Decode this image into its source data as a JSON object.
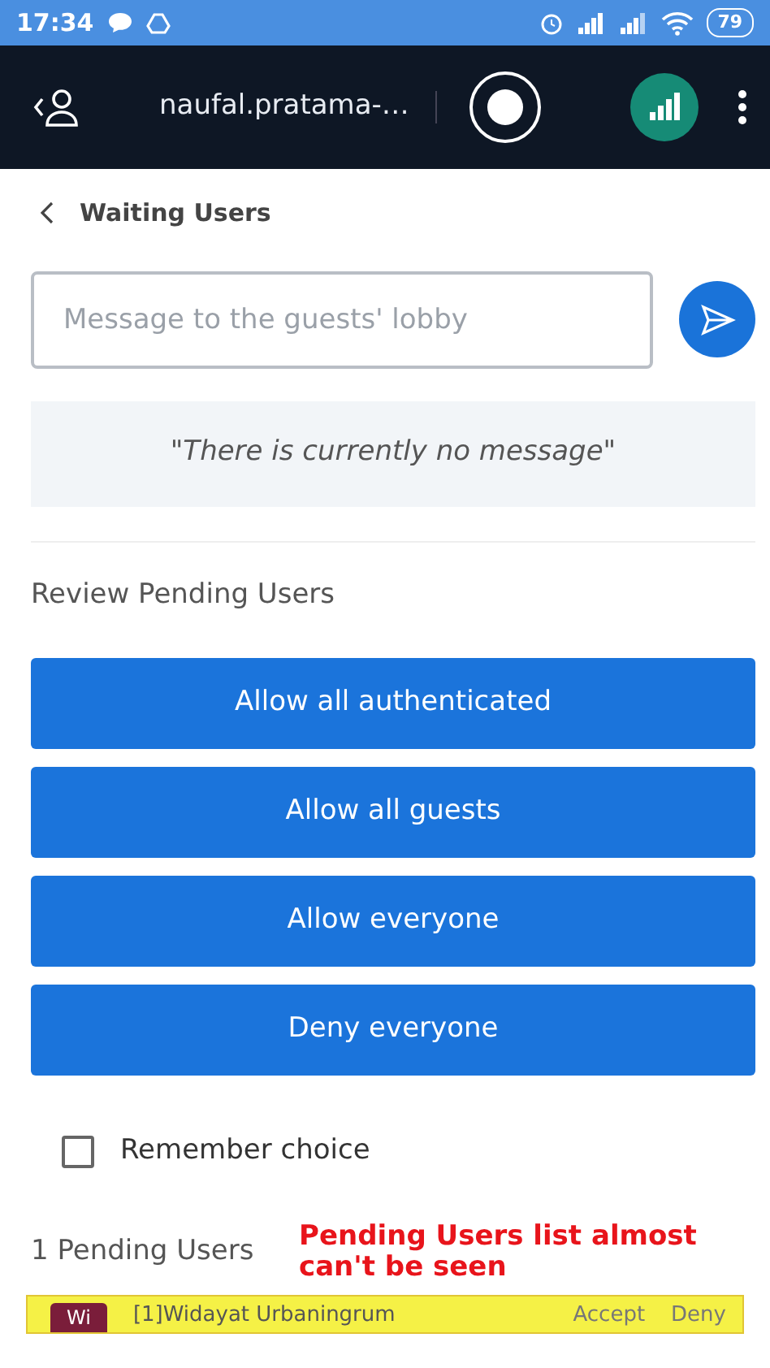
{
  "status_bar": {
    "time": "17:34",
    "battery": "79"
  },
  "top_bar": {
    "title": "naufal.pratama-…"
  },
  "header": {
    "back_label": "Waiting Users"
  },
  "message_field": {
    "placeholder": "Message to the guests' lobby"
  },
  "current_message": "\"There is currently no message\"",
  "review_title": "Review Pending Users",
  "buttons": [
    "Allow all authenticated",
    "Allow all guests",
    "Allow everyone",
    "Deny everyone"
  ],
  "remember": {
    "label": "Remember choice",
    "checked": false
  },
  "pending_count": "1 Pending Users",
  "annotation": "Pending Users list almost can't be seen",
  "pending_users": [
    {
      "avatar": "Wi",
      "name": "[1]Widayat Urbaningrum",
      "accept": "Accept",
      "deny": "Deny"
    }
  ]
}
